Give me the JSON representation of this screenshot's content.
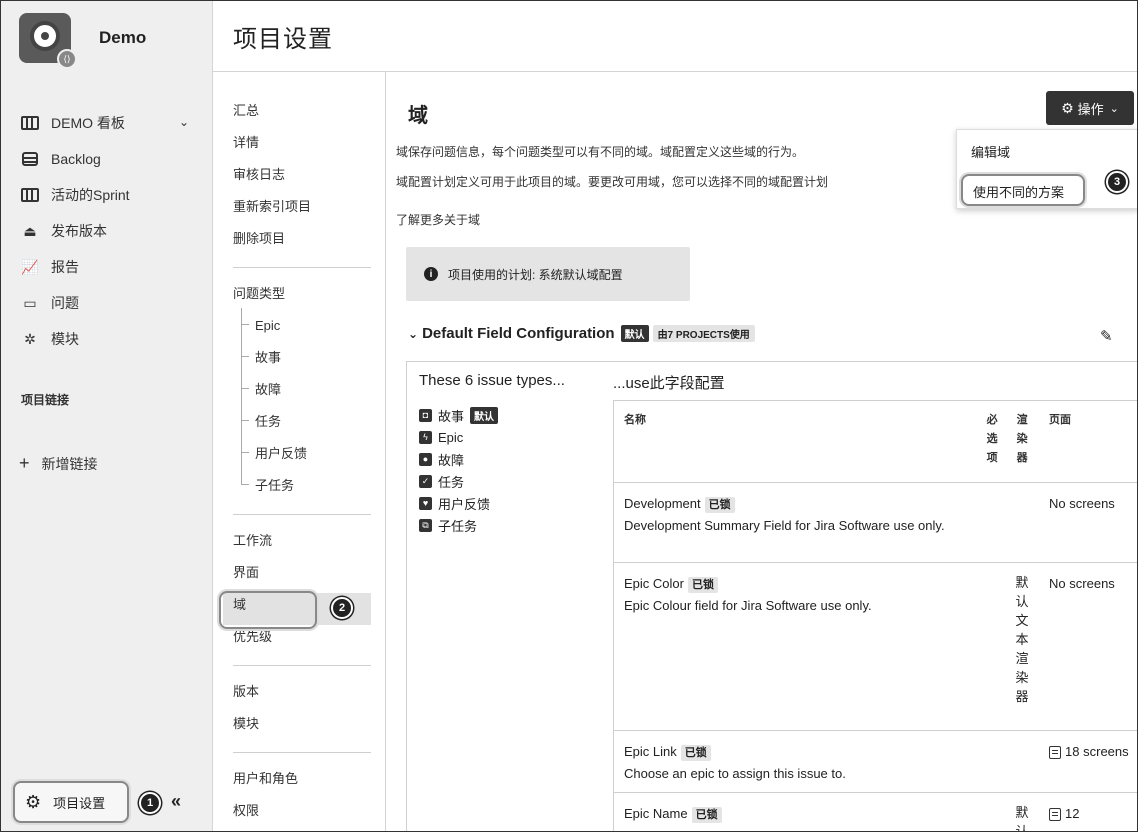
{
  "project": {
    "name": "Demo"
  },
  "nav": {
    "items": [
      {
        "label": "DEMO 看板",
        "icon": "board-icon"
      },
      {
        "label": "Backlog",
        "icon": "backlog-icon"
      },
      {
        "label": "活动的Sprint",
        "icon": "sprint-icon"
      },
      {
        "label": "发布版本",
        "icon": "release-icon"
      },
      {
        "label": "报告",
        "icon": "report-icon"
      },
      {
        "label": "问题",
        "icon": "issues-icon"
      },
      {
        "label": "模块",
        "icon": "components-icon"
      }
    ],
    "section_label": "项目链接",
    "add_link_label": "新增链接",
    "settings_label": "项目设置",
    "callout_1": "1"
  },
  "header": {
    "title": "项目设置"
  },
  "settings_menu": {
    "group1": [
      "汇总",
      "详情",
      "审核日志",
      "重新索引项目",
      "删除项目"
    ],
    "issue_types_label": "问题类型",
    "issue_types": [
      "Epic",
      "故事",
      "故障",
      "任务",
      "用户反馈",
      "子任务"
    ],
    "group3": [
      "工作流",
      "界面",
      "域",
      "优先级"
    ],
    "group4": [
      "版本",
      "模块"
    ],
    "group5": [
      "用户和角色",
      "权限"
    ],
    "callout_2": "2"
  },
  "main": {
    "title": "域",
    "desc1": "域保存问题信息，每个问题类型可以有不同的域。域配置定义这些域的行为。",
    "desc2": "域配置计划定义可用于此项目的域。要更改可用域，您可以选择不同的域配置计划",
    "learn_more": "了解更多关于域",
    "ops_button": "操作",
    "dropdown": {
      "edit": "编辑域",
      "use_different": "使用不同的方案"
    },
    "callout_3": "3",
    "info": "项目使用的计划: 系统默认域配置",
    "config": {
      "name": "Default Field Configuration",
      "default_tag": "默认",
      "used_by": "由7 PROJECTS使用",
      "types_title": "These 6 issue types...",
      "use_title": "...use此字段配置",
      "types": [
        {
          "label": "故事",
          "tag": "默认",
          "icon": "story-icon",
          "glyph": "◘"
        },
        {
          "label": "Epic",
          "tag": "",
          "icon": "epic-icon",
          "glyph": "ϟ"
        },
        {
          "label": "故障",
          "tag": "",
          "icon": "bug-icon",
          "glyph": "●"
        },
        {
          "label": "任务",
          "tag": "",
          "icon": "task-icon",
          "glyph": "✓"
        },
        {
          "label": "用户反馈",
          "tag": "",
          "icon": "feedback-icon",
          "glyph": "♥"
        },
        {
          "label": "子任务",
          "tag": "",
          "icon": "subtask-icon",
          "glyph": "⧉"
        }
      ],
      "table": {
        "headers": {
          "name": "名称",
          "required": "必选项",
          "renderer": "渲染器",
          "screens": "页面"
        },
        "rows": [
          {
            "name": "Development",
            "lock": "已锁",
            "desc": "Development Summary Field for Jira Software use only.",
            "required": "",
            "renderer": "",
            "screens": "No screens",
            "screen_icon": false
          },
          {
            "name": "Epic Color",
            "lock": "已锁",
            "desc": "Epic Colour field for Jira Software use only.",
            "required": "",
            "renderer": "默认文本渲染器",
            "screens": "No screens",
            "screen_icon": false
          },
          {
            "name": "Epic Link",
            "lock": "已锁",
            "desc": "Choose an epic to assign this issue to.",
            "required": "",
            "renderer": "",
            "screens": "18 screens",
            "screen_icon": true
          },
          {
            "name": "Epic Name",
            "lock": "已锁",
            "desc": "",
            "required": "",
            "renderer": "默认",
            "screens": "12",
            "screen_icon": true
          }
        ]
      }
    }
  }
}
